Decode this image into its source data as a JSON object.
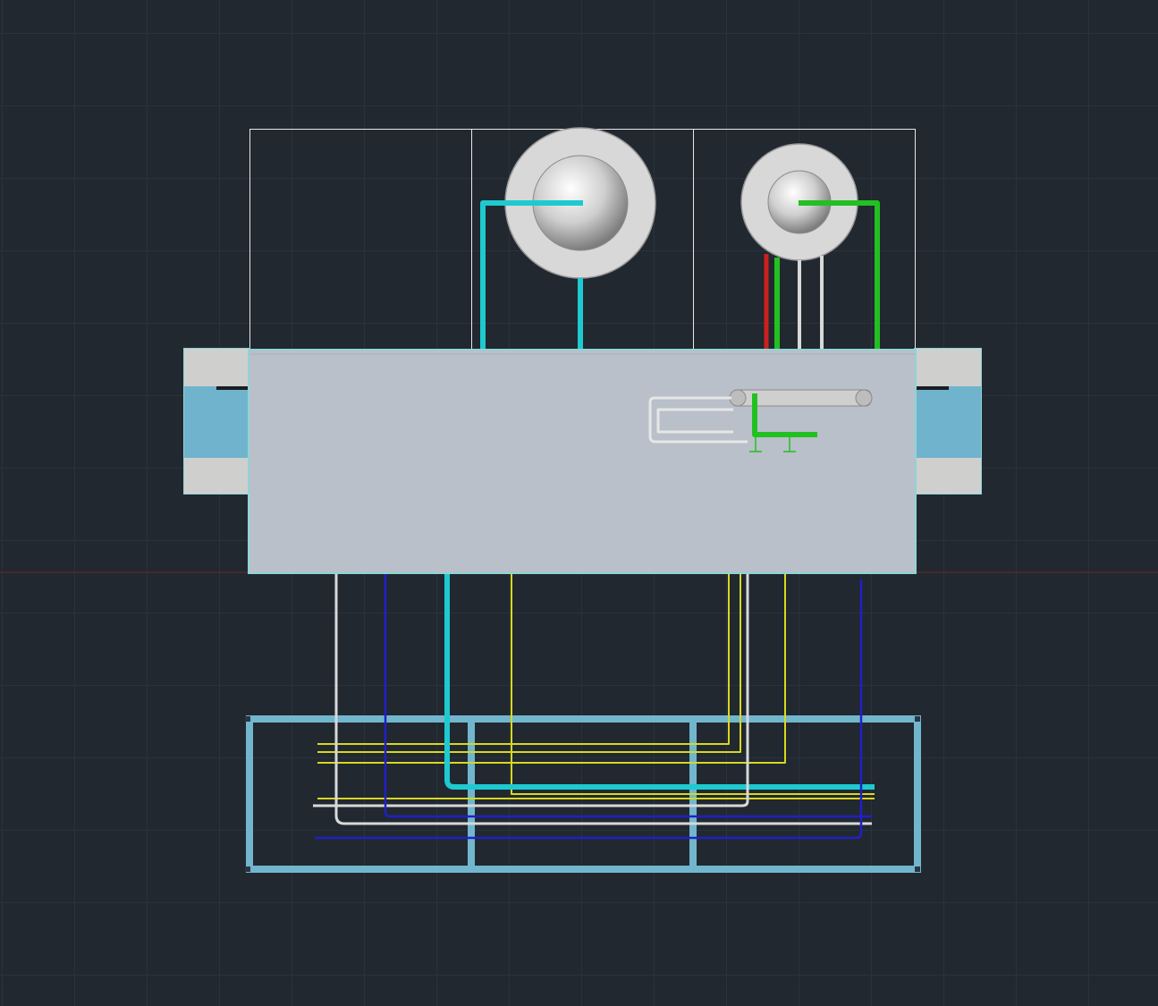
{
  "viewport": {
    "background": "#212830",
    "grid_color": "#2a323c",
    "ucs_x_axis_color": "#7a2a2a"
  },
  "drawing": {
    "colors": {
      "slab": "#b9c0c9",
      "slab_edge": "#8fd4d6",
      "support_cap": "#cfd0ce",
      "support_web": "#6fb3cd",
      "frame": "#72b6ce",
      "vessel": "#d9d9d9",
      "pipe_cyan": "#1ec9d0",
      "pipe_green": "#22c021",
      "pipe_red": "#cc2020",
      "pipe_white": "#d8d8d8",
      "pipe_yellow": "#d8d820",
      "pipe_blue": "#2020c8"
    },
    "components": [
      "top-boundary-box",
      "main-slab",
      "left-support",
      "right-support",
      "large-vessel",
      "small-vessel",
      "heat-exchanger-assembly",
      "bottom-frame",
      "pipe-bundle"
    ]
  }
}
